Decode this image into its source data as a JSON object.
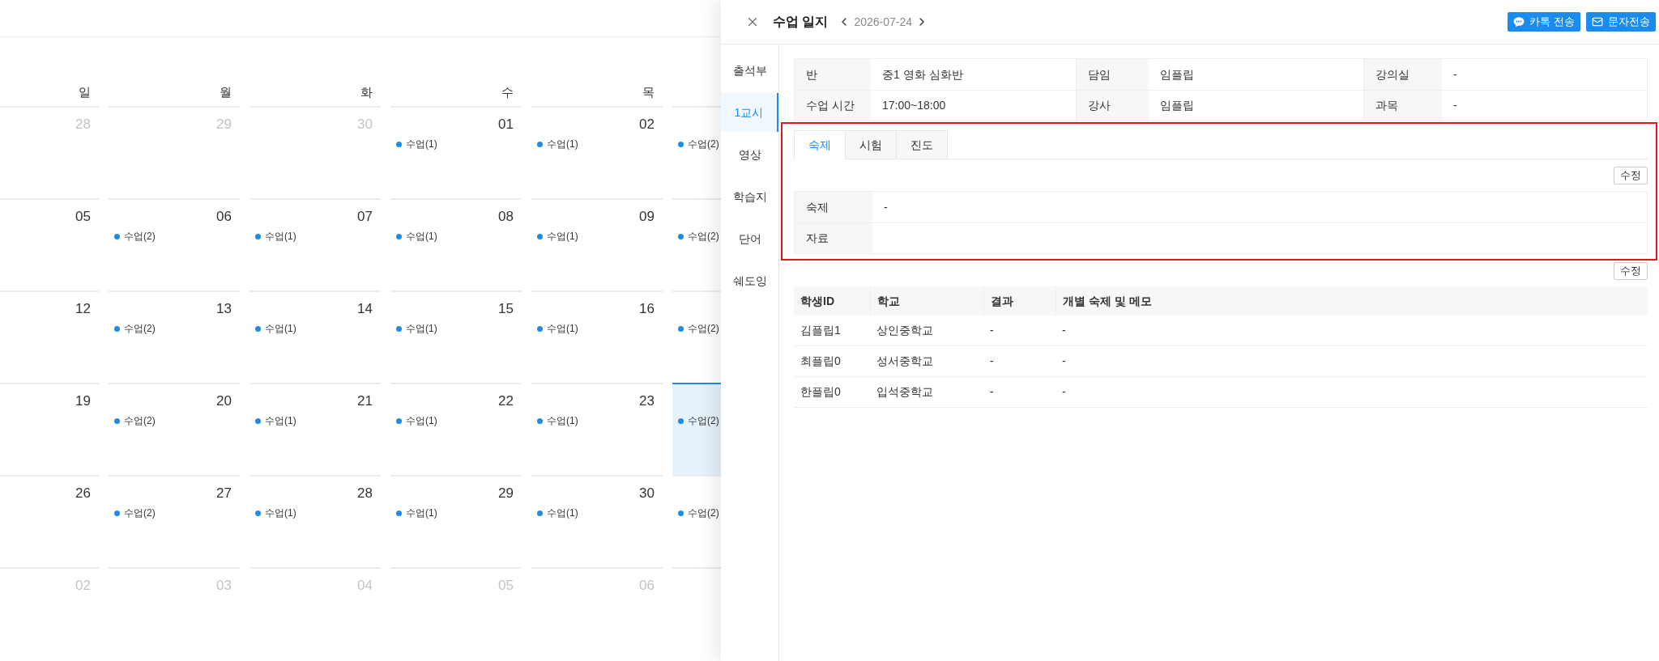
{
  "calendar": {
    "weekdays": [
      "일",
      "월",
      "화",
      "수",
      "목"
    ],
    "weeks": [
      {
        "days": [
          {
            "date": "28",
            "muted": true,
            "selected": false
          },
          {
            "date": "29",
            "muted": true,
            "selected": false
          },
          {
            "date": "30",
            "muted": true,
            "selected": false
          },
          {
            "date": "01",
            "muted": false,
            "selected": false,
            "events": [
              "수업(1)"
            ]
          },
          {
            "date": "02",
            "muted": false,
            "selected": false,
            "events": [
              "수업(1)"
            ]
          },
          {
            "selected": false,
            "events": [
              "수업(2)"
            ]
          }
        ]
      },
      {
        "days": [
          {
            "date": "05",
            "muted": false,
            "selected": false
          },
          {
            "date": "06",
            "muted": false,
            "selected": false,
            "events": [
              "수업(2)"
            ]
          },
          {
            "date": "07",
            "muted": false,
            "selected": false,
            "events": [
              "수업(1)"
            ]
          },
          {
            "date": "08",
            "muted": false,
            "selected": false,
            "events": [
              "수업(1)"
            ]
          },
          {
            "date": "09",
            "muted": false,
            "selected": false,
            "events": [
              "수업(1)"
            ]
          },
          {
            "selected": false,
            "events": [
              "수업(2)"
            ]
          }
        ]
      },
      {
        "days": [
          {
            "date": "12",
            "muted": false,
            "selected": false
          },
          {
            "date": "13",
            "muted": false,
            "selected": false,
            "events": [
              "수업(2)"
            ]
          },
          {
            "date": "14",
            "muted": false,
            "selected": false,
            "events": [
              "수업(1)"
            ]
          },
          {
            "date": "15",
            "muted": false,
            "selected": false,
            "events": [
              "수업(1)"
            ]
          },
          {
            "date": "16",
            "muted": false,
            "selected": false,
            "events": [
              "수업(1)"
            ]
          },
          {
            "selected": false,
            "events": [
              "수업(2)"
            ]
          }
        ]
      },
      {
        "days": [
          {
            "date": "19",
            "muted": false,
            "selected": false
          },
          {
            "date": "20",
            "muted": false,
            "selected": false,
            "events": [
              "수업(2)"
            ]
          },
          {
            "date": "21",
            "muted": false,
            "selected": false,
            "events": [
              "수업(1)"
            ]
          },
          {
            "date": "22",
            "muted": false,
            "selected": false,
            "events": [
              "수업(1)"
            ]
          },
          {
            "date": "23",
            "muted": false,
            "selected": false,
            "events": [
              "수업(1)"
            ]
          },
          {
            "selected": true,
            "events": [
              "수업(2)"
            ]
          }
        ]
      },
      {
        "days": [
          {
            "date": "26",
            "muted": false,
            "selected": false
          },
          {
            "date": "27",
            "muted": false,
            "selected": false,
            "events": [
              "수업(2)"
            ]
          },
          {
            "date": "28",
            "muted": false,
            "selected": false,
            "events": [
              "수업(1)"
            ]
          },
          {
            "date": "29",
            "muted": false,
            "selected": false,
            "events": [
              "수업(1)"
            ]
          },
          {
            "date": "30",
            "muted": false,
            "selected": false,
            "events": [
              "수업(1)"
            ]
          },
          {
            "selected": false,
            "events": [
              "수업(2)"
            ]
          }
        ]
      },
      {
        "days": [
          {
            "date": "02",
            "muted": true,
            "selected": false
          },
          {
            "date": "03",
            "muted": true,
            "selected": false
          },
          {
            "date": "04",
            "muted": true,
            "selected": false
          },
          {
            "date": "05",
            "muted": true,
            "selected": false
          },
          {
            "date": "06",
            "muted": true,
            "selected": false
          },
          {
            "selected": false
          }
        ]
      }
    ]
  },
  "drawer": {
    "title": "수업 일지",
    "date": "2026-07-24",
    "actions": [
      {
        "label": "카톡 전송",
        "kind": "kakao"
      },
      {
        "label": "문자전송",
        "kind": "sms"
      }
    ],
    "nav": [
      {
        "label": "출석부",
        "selected": false
      },
      {
        "label": "1교시",
        "selected": true
      },
      {
        "label": "영상",
        "selected": false
      },
      {
        "label": "학습지",
        "selected": false
      },
      {
        "label": "단어",
        "selected": false
      },
      {
        "label": "쉐도잉",
        "selected": false
      }
    ],
    "info": [
      [
        {
          "label": "반",
          "value": "중1 영화 심화반"
        },
        {
          "label": "담임",
          "value": "임플립"
        },
        {
          "label": "강의실",
          "value": "-"
        }
      ],
      [
        {
          "label": "수업 시간",
          "value": "17:00~18:00"
        },
        {
          "label": "강사",
          "value": "임플립"
        },
        {
          "label": "과목",
          "value": "-"
        }
      ]
    ],
    "homework": {
      "highlighted": true,
      "tabs": [
        {
          "label": "숙제",
          "selected": true
        },
        {
          "label": "시험",
          "selected": false
        },
        {
          "label": "진도",
          "selected": false
        }
      ],
      "edit_button": "수정",
      "fields": [
        {
          "label": "숙제",
          "value": "-"
        },
        {
          "label": "자료"
        }
      ]
    },
    "students": {
      "edit_button": "수정",
      "columns": [
        "학생ID",
        "학교",
        "결과",
        "개별 숙제 및 메모"
      ],
      "rows": [
        [
          "김플립1",
          "상인중학교",
          "-",
          "-"
        ],
        [
          "최플립0",
          "성서중학교",
          "-",
          "-"
        ],
        [
          "한플립0",
          "입석중학교",
          "-",
          "-"
        ]
      ]
    }
  }
}
